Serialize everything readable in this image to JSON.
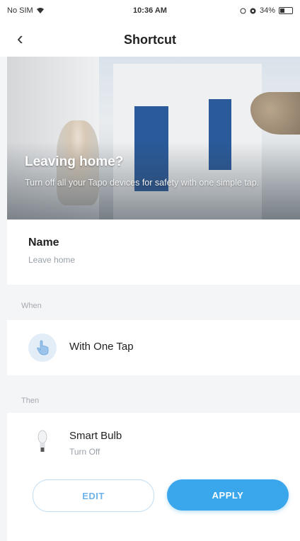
{
  "status_bar": {
    "carrier": "No SIM",
    "time": "10:36 AM",
    "battery": "34%"
  },
  "nav": {
    "back_icon": "‹",
    "title": "Shortcut"
  },
  "hero": {
    "title": "Leaving home?",
    "subtitle": "Turn off all your Tapo devices for safety with one simple tap."
  },
  "name": {
    "label": "Name",
    "value": "Leave home"
  },
  "when": {
    "section_label": "When",
    "trigger": "With One Tap"
  },
  "then": {
    "section_label": "Then",
    "device_name": "Smart Bulb",
    "device_action": "Turn Off"
  },
  "buttons": {
    "edit": "EDIT",
    "apply": "APPLY"
  },
  "colors": {
    "accent": "#3aa6ec",
    "door": "#2a5a9a",
    "background": "#f4f5f7"
  }
}
